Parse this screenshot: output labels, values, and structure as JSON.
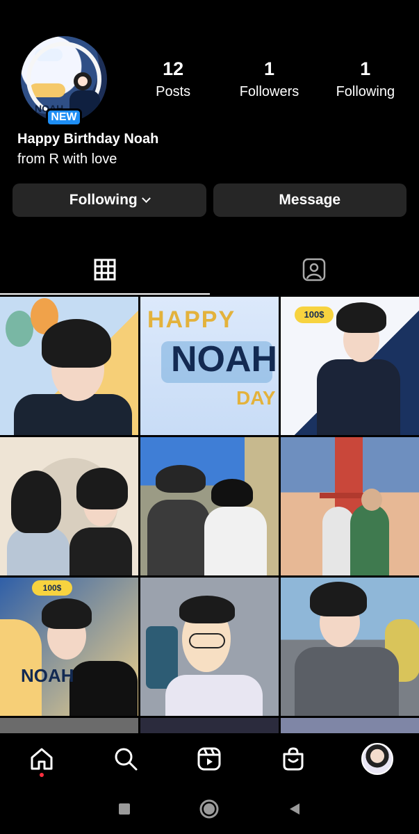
{
  "profile": {
    "badge": "NEW",
    "avatar_text": "NOAH",
    "name": "Happy Birthday Noah",
    "bio": "from R with love"
  },
  "stats": [
    {
      "value": "12",
      "label": "Posts"
    },
    {
      "value": "1",
      "label": "Followers"
    },
    {
      "value": "1",
      "label": "Following"
    }
  ],
  "actions": {
    "following_label": "Following",
    "message_label": "Message"
  },
  "tabs": [
    {
      "name": "grid",
      "icon": "grid-icon",
      "active": true
    },
    {
      "name": "tagged",
      "icon": "tagged-icon",
      "active": false
    }
  ],
  "posts": {
    "p2_line1": "HAPPY",
    "p2_line2": "NOAH",
    "p2_line3": "DAY",
    "p3_badge": "100$",
    "p7_text": "NOAH",
    "p7_badge": "100$"
  },
  "bottom_nav": [
    "home-icon",
    "search-icon",
    "reels-icon",
    "shop-icon",
    "profile-avatar"
  ],
  "colors": {
    "background": "#000000",
    "button": "#262626",
    "badge": "#1e8ef5",
    "notification_dot": "#ff3040"
  }
}
